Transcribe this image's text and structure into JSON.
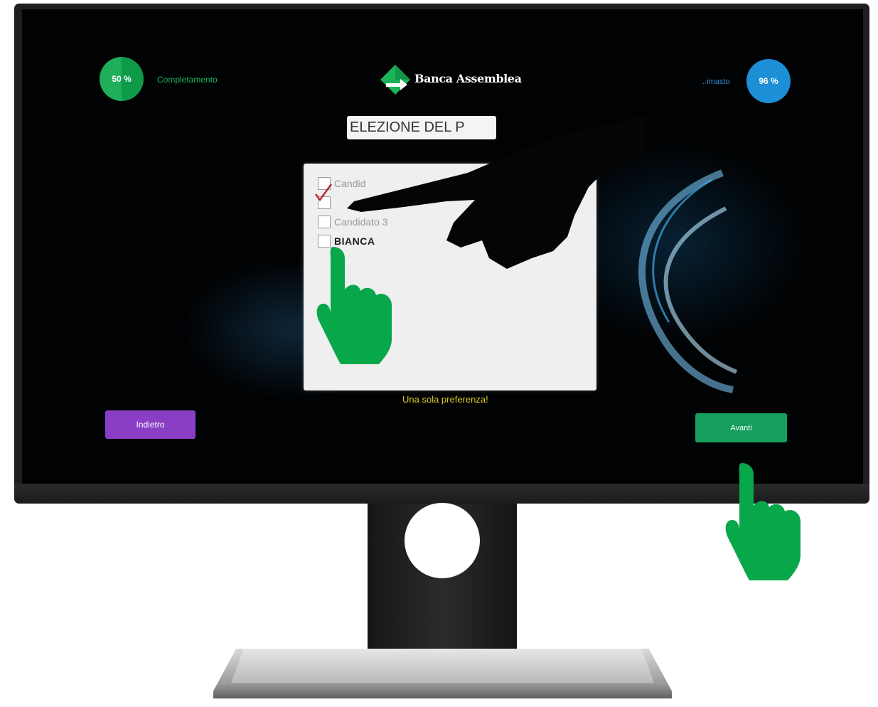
{
  "header": {
    "completion": {
      "percent_label": "50 %",
      "label": "Completamento",
      "value": 0.5
    },
    "brand": {
      "name": "Banca Assemblea"
    },
    "remaining": {
      "label": "..imasto",
      "percent_label": "96 %"
    }
  },
  "ballot": {
    "title": "ELEZIONE DEL P",
    "candidates": [
      {
        "label": "Candid",
        "checked": false
      },
      {
        "label": "",
        "checked": true
      },
      {
        "label": "Candidato 3",
        "checked": false
      },
      {
        "label": "BIANCA",
        "checked": false
      }
    ],
    "instruction": "Una sola preferenza!"
  },
  "navigation": {
    "back_label": "Indietro",
    "next_label": "Avanti"
  },
  "icons": {
    "pointer": "pointing-hand-icon",
    "check": "checkmark-icon",
    "logo": "diamond-arrow-logo"
  },
  "colors": {
    "completion": "#1fae59",
    "remaining": "#1d8fd6",
    "back_button": "#8a3ec6",
    "next_button": "#159e5e",
    "instruction": "#d9cb2a",
    "pointer": "#08a84a"
  }
}
